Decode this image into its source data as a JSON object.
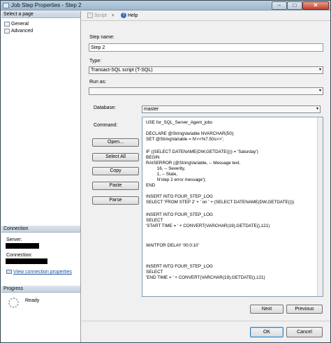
{
  "window": {
    "title": "Job Step Properties - Step 2",
    "minimize_glyph": "–",
    "maximize_glyph": "□",
    "close_glyph": "✕"
  },
  "left_pane": {
    "select_page_header": "Select a page",
    "pages": [
      {
        "label": "General",
        "icon": "page-icon"
      },
      {
        "label": "Advanced",
        "icon": "page-icon"
      }
    ],
    "connection_header": "Connection",
    "server_label": "Server:",
    "connection_label": "Connection:",
    "view_connection_link": "View connection properties",
    "progress_header": "Progress",
    "progress_status": "Ready"
  },
  "toolbar": {
    "script_label": "Script",
    "script_dropdown_glyph": "▾",
    "help_label": "Help",
    "help_glyph": "?"
  },
  "form": {
    "step_name_label": "Step name:",
    "step_name_value": "Step 2",
    "type_label": "Type:",
    "type_value": "Transact-SQL script (T-SQL)",
    "run_as_label": "Run as:",
    "run_as_value": "",
    "database_label": "Database:",
    "database_value": "master",
    "command_label": "Command:",
    "combo_arrow": "▾"
  },
  "command_buttons": [
    "Open...",
    "Select All",
    "Copy",
    "Paste",
    "Parse"
  ],
  "command_text": [
    "USE for_SQL_Server_Agent_jobs",
    "",
    "DECLARE @StringVariable NVARCHAR(50);",
    "SET @StringVariable = N'<<%7.50s>>';",
    "",
    "IF ((SELECT DATENAME(DW,GETDATE())) = 'Saturday')",
    "BEGIN",
    "RAISERROR (@StringVariable, -- Message text.",
    "         16, -- Severity,",
    "         1, -- State,",
    "         N'step 2 error message');",
    "END",
    "",
    "INSERT INTO FOUR_STEP_LOG",
    "SELECT 'FROM STEP 2' + ' on ' + (SELECT DATENAME(DW,GETDATE()))",
    "",
    "INSERT INTO FOUR_STEP_LOG",
    "SELECT",
    "'START TIME = ' + CONVERT(VARCHAR(19),GETDATE(),121)",
    "",
    "",
    "WAITFOR DELAY '00:0:10'",
    "",
    "",
    "INSERT INTO FOUR_STEP_LOG",
    "SELECT",
    "'END TIME = ' + CONVERT(VARCHAR(19),GETDATE(),121)"
  ],
  "nav_buttons": {
    "next": "Next",
    "previous": "Previous"
  },
  "dialog_buttons": {
    "ok": "OK",
    "cancel": "Cancel"
  }
}
